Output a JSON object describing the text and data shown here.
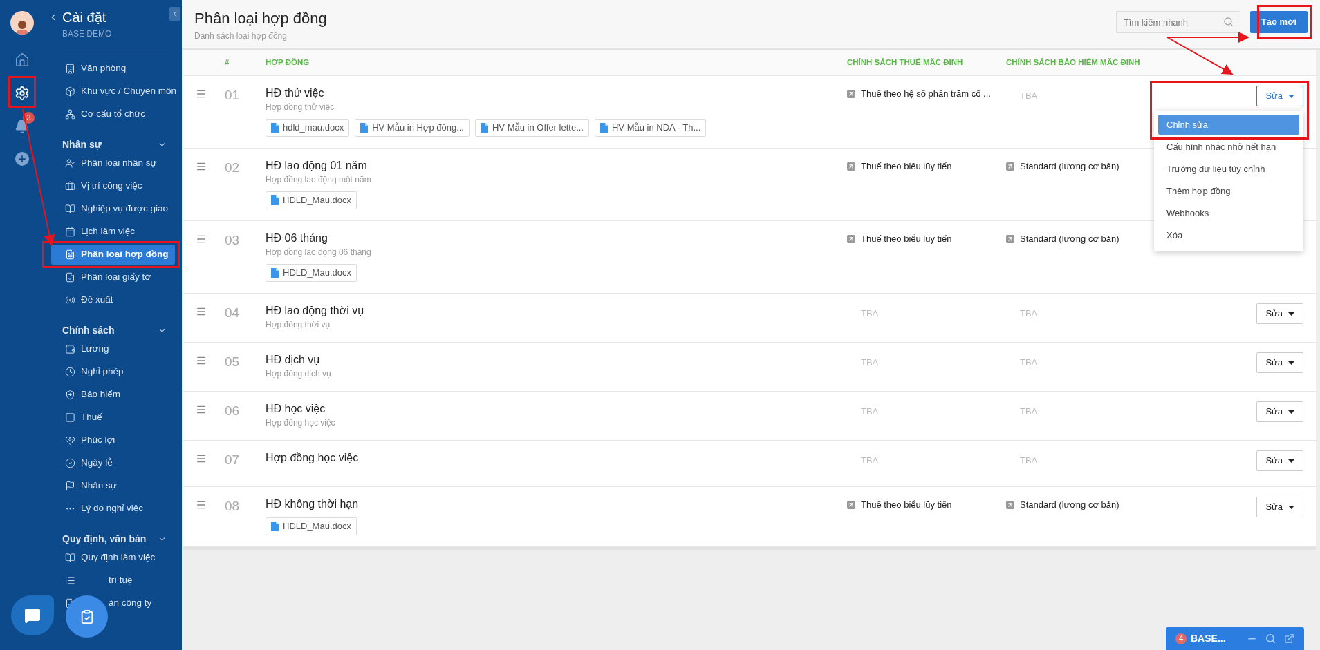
{
  "rail": {
    "notification_count": "3"
  },
  "sidebar": {
    "title": "Cài đặt",
    "subtitle": "BASE DEMO",
    "items": [
      {
        "label": "Văn phòng",
        "selected": false
      },
      {
        "label": "Khu vực / Chuyên môn",
        "selected": false
      },
      {
        "label": "Cơ cấu tổ chức",
        "selected": false
      }
    ],
    "sections": [
      {
        "title": "Nhân sự",
        "expanded": true,
        "items": [
          {
            "label": "Phân loại nhân sự",
            "selected": false
          },
          {
            "label": "Vị trí công việc",
            "selected": false
          },
          {
            "label": "Nghiệp vụ được giao",
            "selected": false
          },
          {
            "label": "Lịch làm việc",
            "selected": false
          },
          {
            "label": "Phân loại hợp đồng",
            "selected": true
          },
          {
            "label": "Phân loại giấy tờ",
            "selected": false
          },
          {
            "label": "Đề xuất",
            "selected": false
          }
        ]
      },
      {
        "title": "Chính sách",
        "expanded": true,
        "items": [
          {
            "label": "Lương",
            "selected": false
          },
          {
            "label": "Nghỉ phép",
            "selected": false
          },
          {
            "label": "Bảo hiểm",
            "selected": false
          },
          {
            "label": "Thuế",
            "selected": false
          },
          {
            "label": "Phúc lợi",
            "selected": false
          },
          {
            "label": "Ngày lễ",
            "selected": false
          },
          {
            "label": "Nhân sự",
            "selected": false
          },
          {
            "label": "Lý do nghỉ việc",
            "selected": false
          }
        ]
      },
      {
        "title": "Quy định, văn bản",
        "expanded": true,
        "items": [
          {
            "label": "Quy định làm việc",
            "selected": false
          },
          {
            "label": "trí tuệ",
            "selected": false,
            "kind": "covered"
          },
          {
            "label": "ản công ty",
            "selected": false,
            "kind": "covered"
          }
        ]
      }
    ]
  },
  "page": {
    "title": "Phân loại hợp đồng",
    "subtitle": "Danh sách loại hợp đồng",
    "search": {
      "placeholder": "Tìm kiếm nhanh"
    },
    "create_button": "Tạo mới"
  },
  "table": {
    "columns": [
      "#",
      "HỢP ĐỒNG",
      "CHÍNH SÁCH THUẾ MẶC ĐỊNH",
      "CHÍNH SÁCH BẢO HIỂM MẶC ĐỊNH"
    ],
    "rows": [
      {
        "number": "01",
        "name": "HĐ thử việc",
        "description": "Hợp đồng thử việc",
        "files": [
          "hdld_mau.docx",
          "HV Mẫu in Hợp đồng...",
          "HV Mẫu in Offer lette...",
          "HV Mẫu in NDA - Th..."
        ],
        "tax": {
          "kind": "link",
          "text": "Thuế theo hệ số phần trăm cố ..."
        },
        "insurance": {
          "kind": "empty",
          "text": "TBA"
        },
        "action": {
          "label": "Sửa",
          "open": true,
          "menu": [
            {
              "label": "Chỉnh sửa",
              "selected": true
            },
            {
              "label": "Cấu hình nhắc nhở hết hạn",
              "selected": false
            },
            {
              "label": "Trường dữ liệu tùy chỉnh",
              "selected": false
            },
            {
              "label": "Thêm hợp đồng",
              "selected": false
            },
            {
              "label": "Webhooks",
              "selected": false
            },
            {
              "label": "Xóa",
              "selected": false
            }
          ]
        }
      },
      {
        "number": "02",
        "name": "HĐ lao động 01 năm",
        "description": "Hợp đồng lao động một năm",
        "files": [
          "HDLD_Mau.docx"
        ],
        "tax": {
          "kind": "link",
          "text": "Thuế theo biểu lũy tiến"
        },
        "insurance": {
          "kind": "link",
          "text": "Standard (lương cơ bản)"
        }
      },
      {
        "number": "03",
        "name": "HĐ 06 tháng",
        "description": "Hợp đồng lao động 06 tháng",
        "files": [
          "HDLD_Mau.docx"
        ],
        "tax": {
          "kind": "link",
          "text": "Thuế theo biểu lũy tiến"
        },
        "insurance": {
          "kind": "link",
          "text": "Standard (lương cơ bản)"
        }
      },
      {
        "number": "04",
        "name": "HĐ lao động thời vụ",
        "description": "Hợp đồng thời vụ",
        "tax": {
          "kind": "empty",
          "text": "TBA"
        },
        "insurance": {
          "kind": "empty",
          "text": "TBA"
        },
        "action": {
          "label": "Sửa",
          "open": false
        }
      },
      {
        "number": "05",
        "name": "HĐ dịch vụ",
        "description": "Hợp đồng dịch vụ",
        "tax": {
          "kind": "empty",
          "text": "TBA"
        },
        "insurance": {
          "kind": "empty",
          "text": "TBA"
        },
        "action": {
          "label": "Sửa",
          "open": false
        }
      },
      {
        "number": "06",
        "name": "HĐ học việc",
        "description": "Hợp đồng học việc",
        "tax": {
          "kind": "empty",
          "text": "TBA"
        },
        "insurance": {
          "kind": "empty",
          "text": "TBA"
        },
        "action": {
          "label": "Sửa",
          "open": false
        }
      },
      {
        "number": "07",
        "name": "Hợp đồng học việc",
        "tax": {
          "kind": "empty",
          "text": "TBA"
        },
        "insurance": {
          "kind": "empty",
          "text": "TBA"
        },
        "action": {
          "label": "Sửa",
          "open": false
        }
      },
      {
        "number": "08",
        "name": "HĐ không thời hạn",
        "files": [
          "HDLD_Mau.docx"
        ],
        "tax": {
          "kind": "link",
          "text": "Thuế theo biểu lũy tiến"
        },
        "insurance": {
          "kind": "link",
          "text": "Standard (lương cơ bản)"
        },
        "action": {
          "label": "Sửa",
          "open": false
        }
      }
    ]
  },
  "chat_widget": {
    "count": "4",
    "title": "BASE..."
  }
}
